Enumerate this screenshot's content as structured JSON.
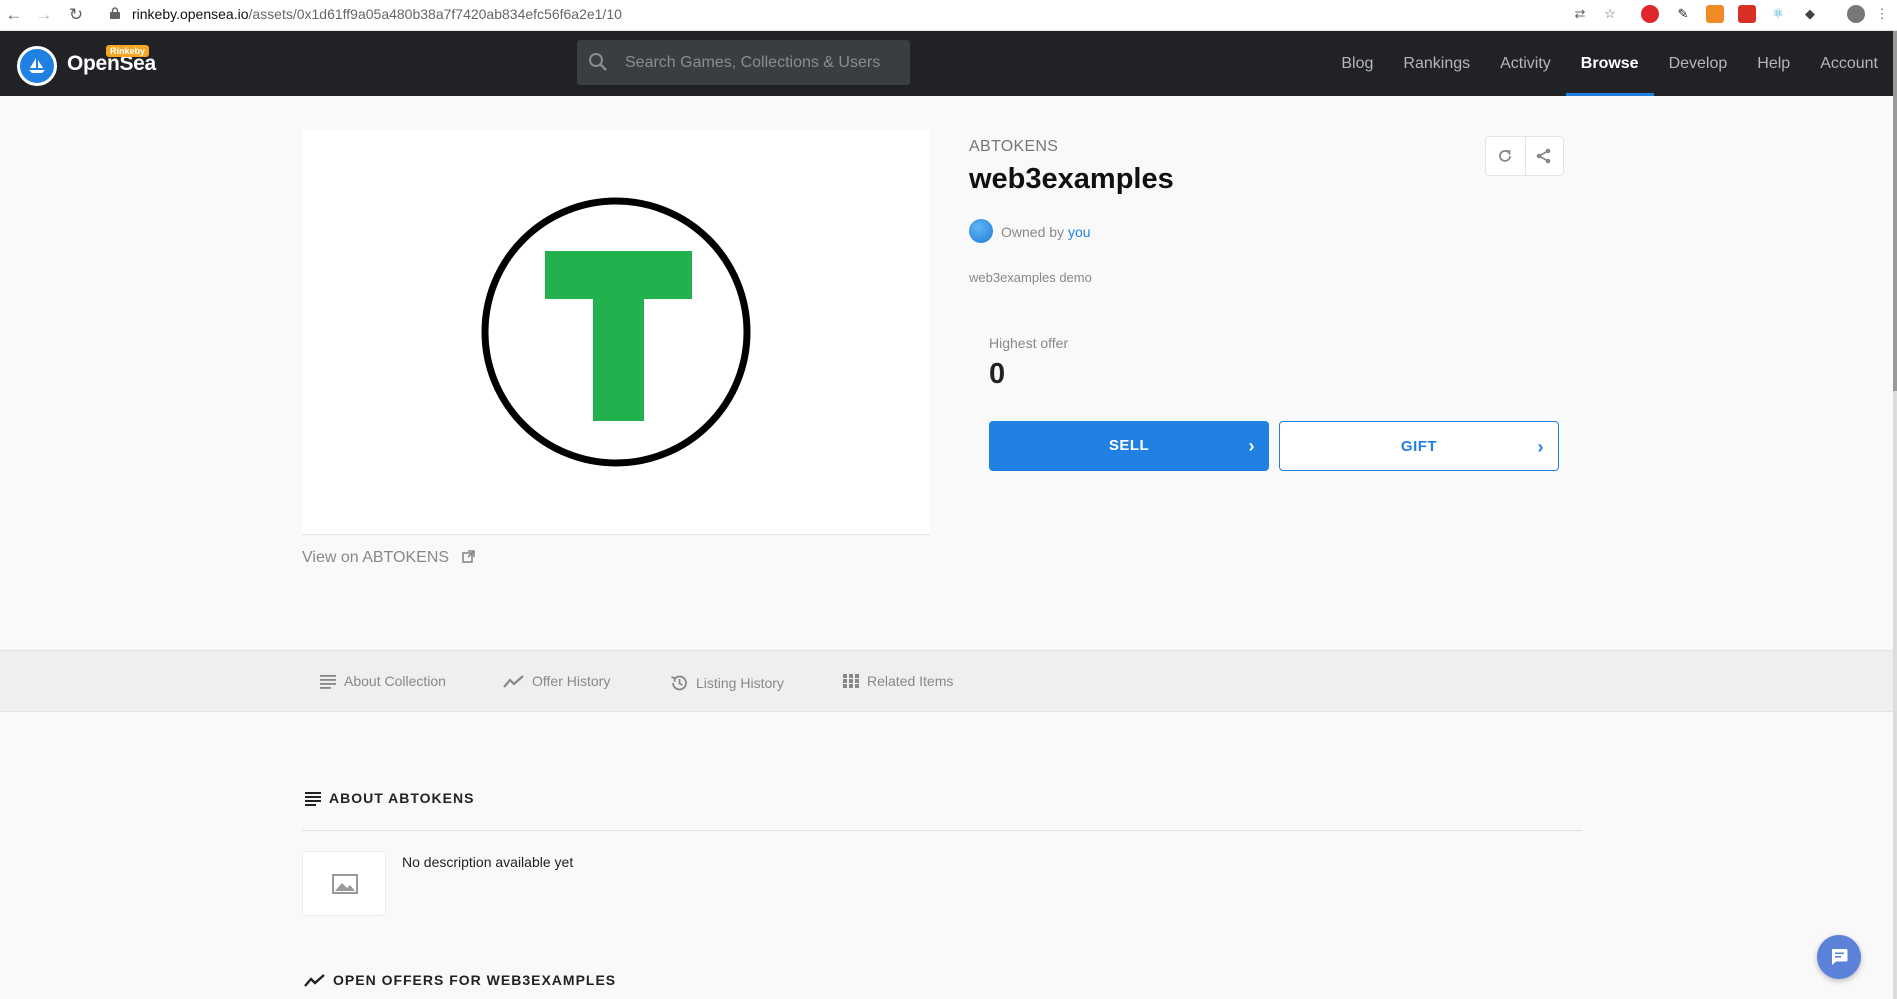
{
  "browser": {
    "url_host": "rinkeby.opensea.io",
    "url_path": "/assets/0x1d61ff9a05a480b38a7f7420ab834efc56f6a2e1/10"
  },
  "nav": {
    "brand": "OpenSea",
    "badge": "Rinkeby",
    "search_placeholder": "Search Games, Collections & Users",
    "links": [
      "Blog",
      "Rankings",
      "Activity",
      "Browse",
      "Develop",
      "Help",
      "Account"
    ],
    "active": "Browse",
    "accent_color": "#2081e2"
  },
  "asset": {
    "collection": "ABTOKENS",
    "name": "web3examples",
    "owned_by_label": "Owned by",
    "owner": "you",
    "description": "web3examples demo",
    "view_link": "View on ABTOKENS",
    "highest_offer_label": "Highest offer",
    "highest_offer_value": "0",
    "sell_label": "SELL",
    "gift_label": "GIFT",
    "image_letter_color": "#22b14c"
  },
  "tabs": [
    "About Collection",
    "Offer History",
    "Listing History",
    "Related Items"
  ],
  "sections": {
    "about_title": "ABOUT ABTOKENS",
    "about_text": "No description available yet",
    "offers_title": "OPEN OFFERS FOR WEB3EXAMPLES"
  }
}
